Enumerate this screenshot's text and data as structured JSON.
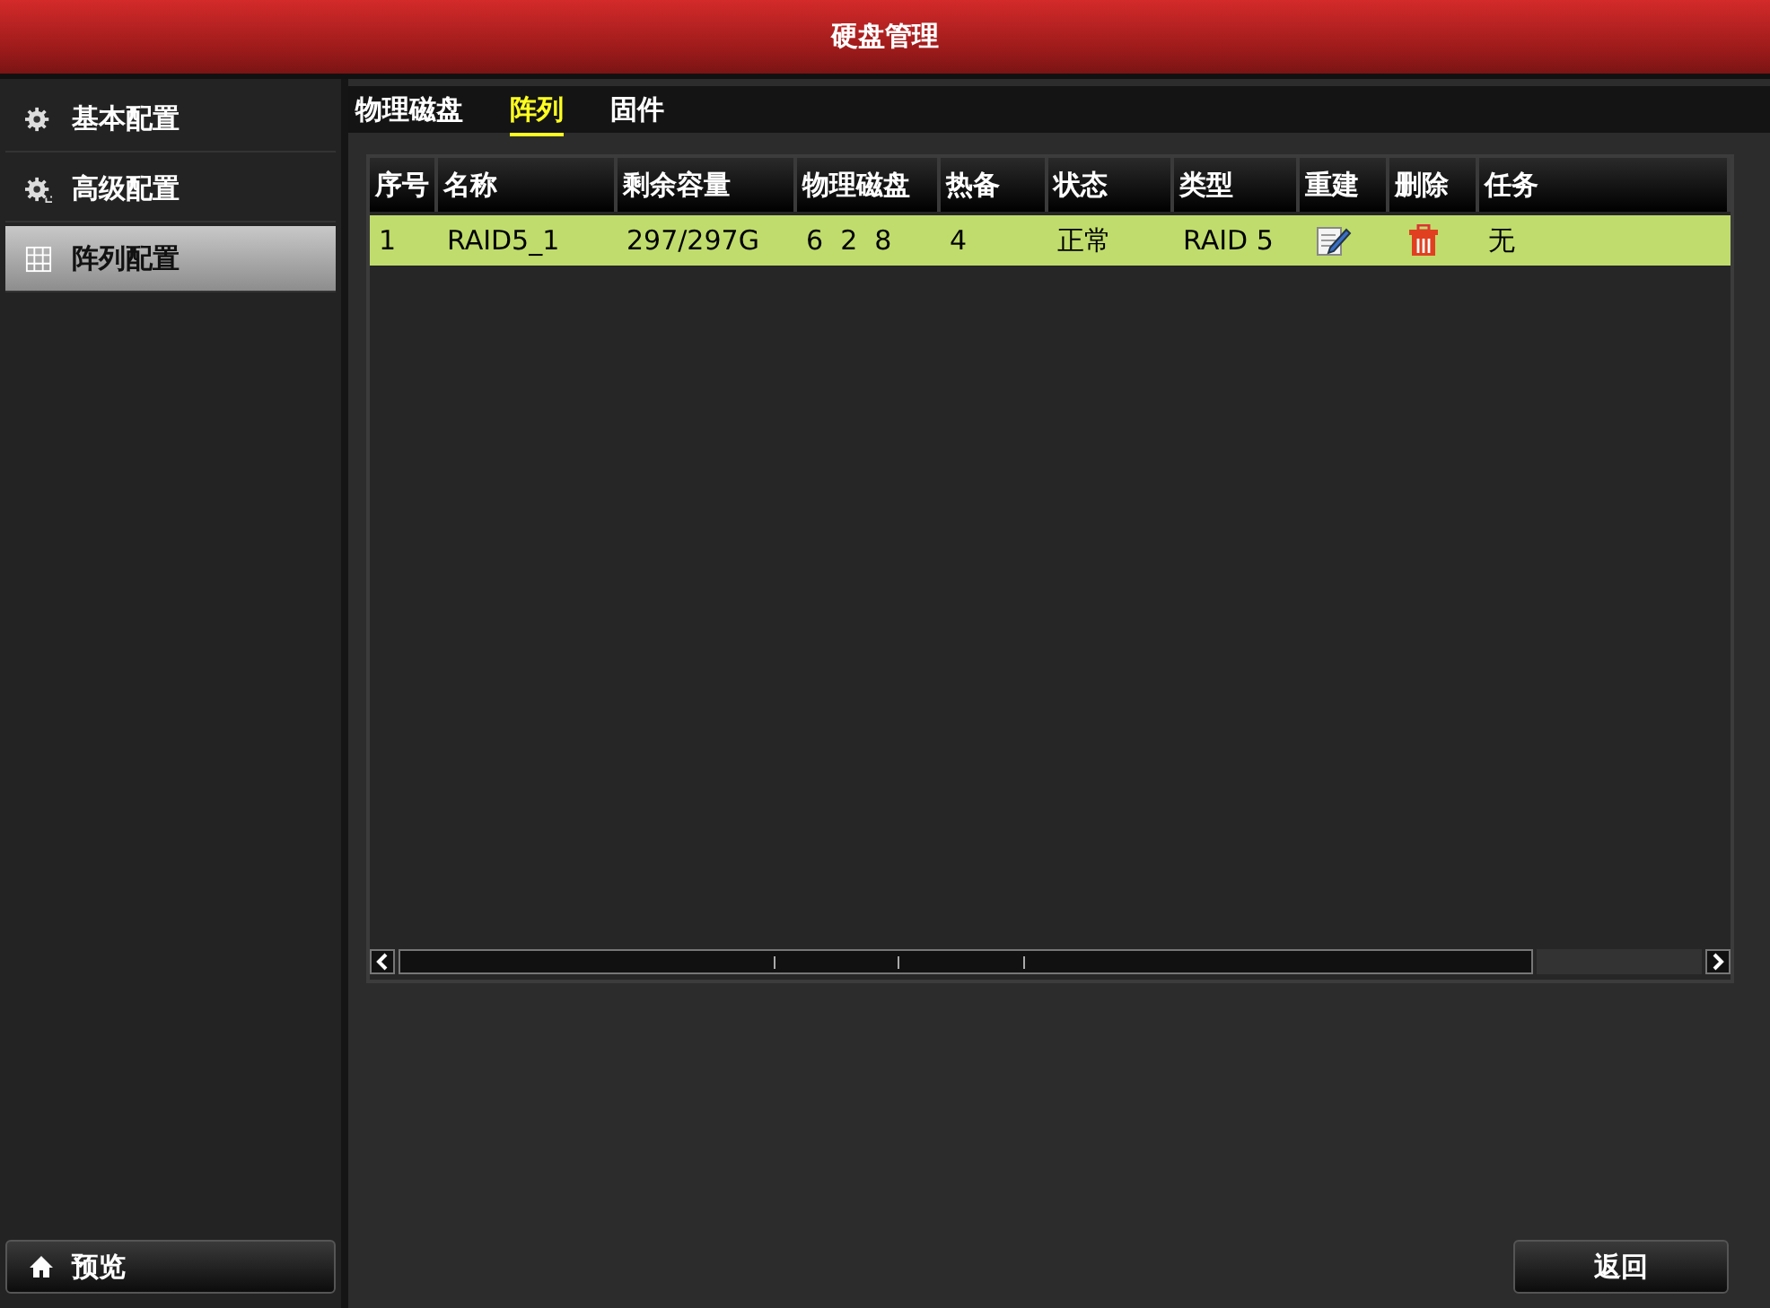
{
  "window": {
    "title": "硬盘管理"
  },
  "sidebar": {
    "items": [
      {
        "label": "基本配置",
        "kind": "basic",
        "selected": false
      },
      {
        "label": "高级配置",
        "kind": "advanced",
        "selected": false
      },
      {
        "label": "阵列配置",
        "kind": "array",
        "selected": true
      }
    ],
    "bottom_button": "预览"
  },
  "tabs": [
    {
      "label": "物理磁盘",
      "selected": false
    },
    {
      "label": "阵列",
      "selected": true
    },
    {
      "label": "固件",
      "selected": false
    }
  ],
  "table": {
    "columns": [
      "序号",
      "名称",
      "剩余容量",
      "物理磁盘",
      "热备",
      "状态",
      "类型",
      "重建",
      "删除",
      "任务"
    ],
    "rows": [
      {
        "selected": true,
        "cells": [
          "1",
          "RAID5_1",
          "297/297G",
          "6  2  8",
          "4",
          "正常",
          "RAID 5",
          null,
          null,
          "无"
        ]
      }
    ]
  },
  "back_button": "返回"
}
